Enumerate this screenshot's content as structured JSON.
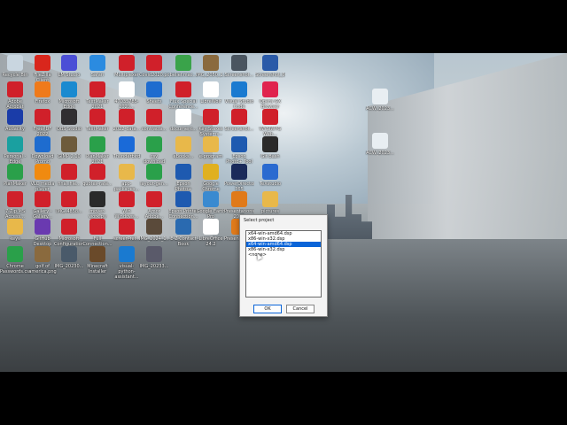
{
  "desktop": {
    "icons": [
      {
        "label": "Recycle Bin",
        "color": "#c9d6e0"
      },
      {
        "label": "FileZilla Client",
        "color": "#d9261c"
      },
      {
        "label": "LM Studio",
        "color": "#4b4fd6"
      },
      {
        "label": "Safari",
        "color": "#2b8be0"
      },
      {
        "label": "Multiplexer",
        "color": "#d0202a"
      },
      {
        "label": "Covid2020.pdf",
        "color": "#d0202a"
      },
      {
        "label": "belief.mac...",
        "color": "#3aa34a"
      },
      {
        "label": "IMG_2050_1...",
        "color": "#8a6a3e"
      },
      {
        "label": "Screenshot...",
        "color": "#4a5560"
      },
      {
        "label": "Screenshot_01...",
        "color": "#2a5aa8"
      },
      {
        "label": "Adobe Acrobat",
        "color": "#d0202a"
      },
      {
        "label": "Firefox",
        "color": "#ef7a1b"
      },
      {
        "label": "Microsoft Edge",
        "color": "#1a8ad0"
      },
      {
        "label": "TextMaker 2021",
        "color": "#d0202a"
      },
      {
        "label": "47035785-2020...",
        "color": "#ffffff"
      },
      {
        "label": "Sheets",
        "color": "#1e6ccf"
      },
      {
        "label": "Flux Special Conference...",
        "color": "#d0202a"
      },
      {
        "label": "LibreWolf",
        "color": "#ffffff"
      },
      {
        "label": "Visual Studio Code",
        "color": "#1a7ad0"
      },
      {
        "label": "Opera GX Browser",
        "color": "#e0234e"
      },
      {
        "label": "Audacity",
        "color": "#1a3ca8"
      },
      {
        "label": "FreePDF 2022",
        "color": "#d0202a"
      },
      {
        "label": "OBS Studio",
        "color": "#302e31"
      },
      {
        "label": "TextMaker",
        "color": "#d0202a"
      },
      {
        "label": "2022-data...",
        "color": "#d0202a"
      },
      {
        "label": "contracts...",
        "color": "#d0202a"
      },
      {
        "label": "document...",
        "color": "#ffffff"
      },
      {
        "label": "Key Stakes Systems - Ca...",
        "color": "#d0202a"
      },
      {
        "label": "Screenshot...",
        "color": "#d0202a"
      },
      {
        "label": "WYSIWYG Web...",
        "color": "#d0202a"
      },
      {
        "label": "Personal - Edge",
        "color": "#1aa0a0"
      },
      {
        "label": "Download Promo",
        "color": "#1e6ccf"
      },
      {
        "label": "GIMP 2.10",
        "color": "#6d5b3c"
      },
      {
        "label": "PlanMaker 2021",
        "color": "#2aa04a"
      },
      {
        "label": "Thunderbird",
        "color": "#1a6ad8"
      },
      {
        "label": "csv download",
        "color": "#2aa04a"
      },
      {
        "label": "eBooks...",
        "color": "#e8b84a"
      },
      {
        "label": "e-program",
        "color": "#e8b84a"
      },
      {
        "label": "Epson Photo+ Tool",
        "color": "#1e5ab0"
      },
      {
        "label": "Git Bash",
        "color": "#2a2a2a"
      },
      {
        "label": "PlanMaker",
        "color": "#2aa04a"
      },
      {
        "label": "VLC media player",
        "color": "#f08a10"
      },
      {
        "label": "final_file...",
        "color": "#d0202a"
      },
      {
        "label": "quotes-rate...",
        "color": "#d0202a"
      },
      {
        "label": "app-packages...",
        "color": "#e8b84a"
      },
      {
        "label": "layout-gen...",
        "color": "#2aa04a"
      },
      {
        "label": "Epson Photo+",
        "color": "#1e5ab0"
      },
      {
        "label": "Google Chrome",
        "color": "#e0b020"
      },
      {
        "label": "PowerDirector 365",
        "color": "#1a2a5a"
      },
      {
        "label": "TeXstudio",
        "color": "#2a6ad0"
      },
      {
        "label": "7-Zip MS Access...",
        "color": "#d0202a"
      },
      {
        "label": "Gallery - Gallery...",
        "color": "#d0202a"
      },
      {
        "label": "IMG_4858...",
        "color": "#d0202a"
      },
      {
        "label": "mover-work.py",
        "color": "#2a2a2a"
      },
      {
        "label": "Win Windows...",
        "color": "#d0202a"
      },
      {
        "label": "Amor Adobe...",
        "color": "#d0202a"
      },
      {
        "label": "Epson Printer Connection...",
        "color": "#1e5ab0"
      },
      {
        "label": "Google Earth Pro",
        "color": "#3a8ad0"
      },
      {
        "label": "Presentations 2021",
        "color": "#e07a1a"
      },
      {
        "label": "pictures",
        "color": "#e8b84a"
      },
      {
        "label": "keys",
        "color": "#e8b84a"
      },
      {
        "label": "GitHub Desktop",
        "color": "#6a3ab0"
      },
      {
        "label": "Microsoft Configuration...",
        "color": "#d0202a"
      },
      {
        "label": "Full Connection...",
        "color": "#d0202a"
      },
      {
        "label": "screen-ref...",
        "color": "#d0202a"
      },
      {
        "label": "IMG_2024_1...",
        "color": "#5a4a3a"
      },
      {
        "label": "E-Z Contact Book",
        "color": "#2a6ab0"
      },
      {
        "label": "LibreOffice 24.2",
        "color": "#ffffff"
      },
      {
        "label": "Presentations",
        "color": "#e07a1a"
      },
      {
        "label": "scans",
        "color": "#e8b84a"
      },
      {
        "label": "Chrome Passwords.csv",
        "color": "#2aa04a"
      },
      {
        "label": "golf of america.png",
        "color": "#8a6a3e"
      },
      {
        "label": "IMG_20230...",
        "color": "#4a5a6a"
      },
      {
        "label": "Minecraft Installer",
        "color": "#6a4a2a"
      },
      {
        "label": "visual-python-assistant...",
        "color": "#1a7ad0"
      },
      {
        "label": "IMG_20233...",
        "color": "#5a5a6a"
      },
      {
        "label": "ACW_2023...",
        "color": "#e8eef2"
      },
      {
        "label": "ACW_2023...",
        "color": "#e8eef2"
      }
    ]
  },
  "dialog": {
    "title": "Select project",
    "items": [
      "x64-win-amd64.dsp",
      "x86-win-x32.dsp",
      "x64-win-amd64.dsp",
      "x86-win-x32.dsp",
      "<none>"
    ],
    "selected_index": 2,
    "ok_label": "OK",
    "cancel_label": "Cancel"
  }
}
